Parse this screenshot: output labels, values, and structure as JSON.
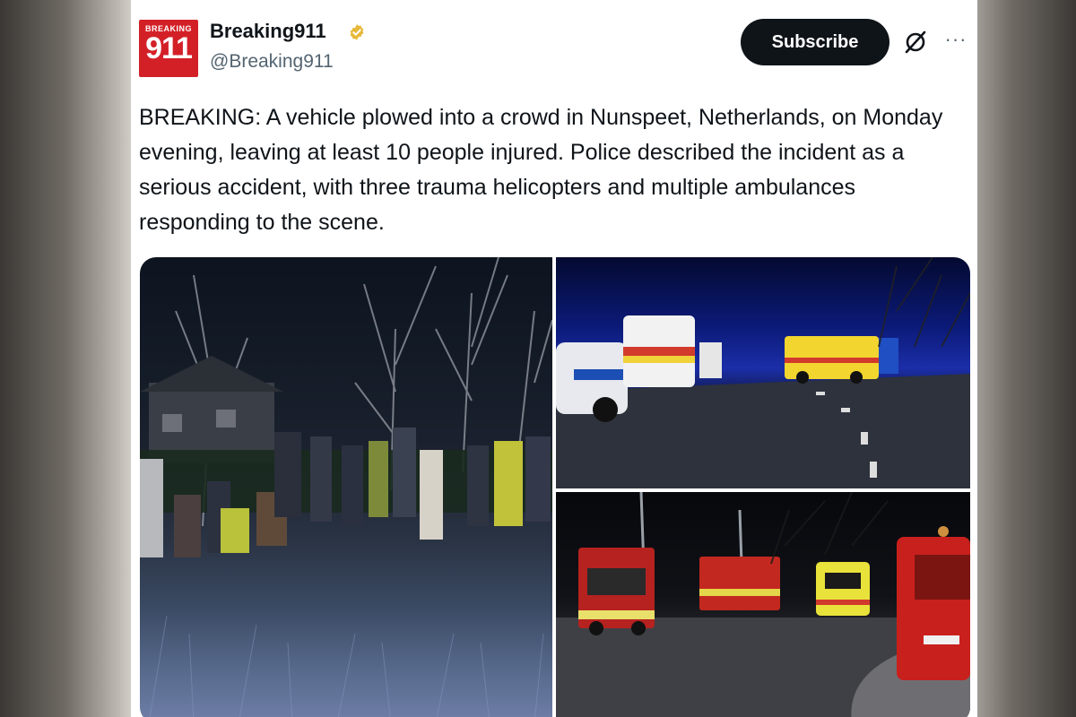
{
  "account": {
    "logo_top": "BREAKING",
    "logo_number": "911",
    "display_name": "Breaking911",
    "handle": "@Breaking911",
    "verified_icon": "verified-badge-icon"
  },
  "actions": {
    "subscribe_label": "Subscribe",
    "grok_icon": "grok-icon",
    "more_label": "···"
  },
  "tweet": {
    "text": "BREAKING: A vehicle plowed into a crowd in Nunspeet, Netherlands, on Monday evening, leaving at least 10 people injured. Police described the incident as a serious accident, with three trauma helicopters and multiple ambulances responding to the scene."
  },
  "media": {
    "photos": [
      {
        "subject": "rescuers-in-field-night"
      },
      {
        "subject": "ambulances-and-police-car-on-road"
      },
      {
        "subject": "fire-trucks-and-ambulance-at-intersection"
      }
    ]
  },
  "colors": {
    "brand_red": "#d32027",
    "text_primary": "#0f1419",
    "text_secondary": "#536471",
    "verified_gold": "#e8b83a"
  }
}
